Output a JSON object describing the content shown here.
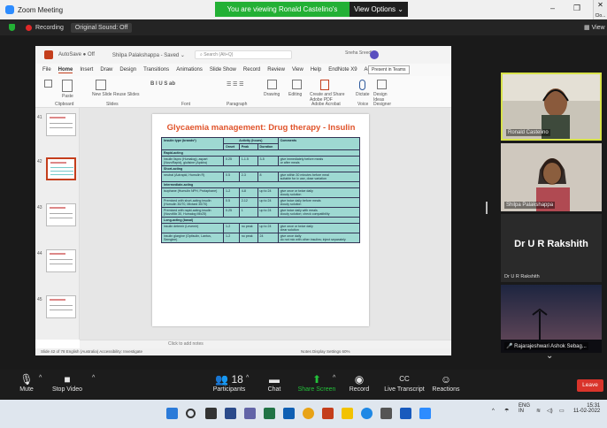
{
  "window": {
    "title": "Zoom Meeting"
  },
  "banner": {
    "viewing": "You are viewing Ronald Castelino's screen",
    "options": "View Options ⌄"
  },
  "window_controls": {
    "minimize": "–",
    "maximize": "❒",
    "close": "Clo..."
  },
  "recording": {
    "label": "Recording",
    "original_sound": "Original Sound: Off",
    "view": "View"
  },
  "ppt": {
    "app_title": "AutoSave ● Off",
    "doc_title": "Shilpa Palakshappa - Saved ⌄",
    "search_placeholder": "Search (Alt+Q)",
    "user": "Sneha Sreedhar",
    "menu": [
      "File",
      "Home",
      "Insert",
      "Draw",
      "Design",
      "Transitions",
      "Animations",
      "Slide Show",
      "Record",
      "Review",
      "View",
      "Help",
      "EndNote X9",
      "Acrobat"
    ],
    "present": "Present in Teams",
    "ribbon_labels": [
      "Paste",
      "Clipboard",
      "New Slide",
      "Reuse Slides",
      "Slides",
      "Font",
      "Paragraph",
      "Drawing",
      "Editing",
      "Create and Share Adobe PDF",
      "Adobe Acrobat",
      "Dictate",
      "Voice",
      "Design Ideas",
      "Designer"
    ],
    "notes": "Click to add notes",
    "status_left": "Slide 42 of 78    English (Australia)    Accessibility: Investigate",
    "status_right": "Notes    Display Settings                    60%"
  },
  "slide": {
    "title": "Glycaemia management: Drug therapy - Insulin",
    "headers": [
      "Insulin type (brands*)",
      "Activity (hours)",
      "Onset",
      "Peak",
      "Duration",
      "Comments"
    ],
    "rows": [
      {
        "section": "Rapid-acting"
      },
      {
        "cells": [
          "insulin lispro (Humalog), aspart (NovoRapid), glulisine (Apidra)",
          "0.25",
          "1-1.5",
          "3-5",
          "give immediately before meals",
          "or after meals"
        ]
      },
      {
        "section": "Short-acting"
      },
      {
        "cells": [
          "neutral (Actrapid, Humulin R)",
          "0.5",
          "2-3",
          "8",
          "give within 30 minutes before meal",
          "suitable for iv use, dose variation"
        ]
      },
      {
        "section": "Intermediate-acting"
      },
      {
        "cells": [
          "isophane (Humulin NPH, Protaphane)",
          "1-2",
          "4-8",
          "up to 24",
          "give once or twice daily",
          "cloudy solution"
        ]
      },
      {
        "cells": [
          "Premixed with short-acting insulin (Humulin 30/70, Mixtard 30/70)",
          "0.5",
          "2-12",
          "up to 24",
          "give twice daily before meals",
          "cloudy solution"
        ]
      },
      {
        "cells": [
          "Premixed with rapid-acting insulin (NovoMix 30, Humalog Mix25)",
          "0.25",
          "1",
          "up to 24",
          "give twice daily with meals",
          "cloudy solution; check compatibility"
        ]
      },
      {
        "section": "Long-acting (basal)"
      },
      {
        "cells": [
          "insulin detemir (Levemir)",
          "1-2",
          "no peak",
          "up to 24",
          "give once or twice daily",
          "clear solution"
        ]
      },
      {
        "cells": [
          "insulin glargine (Optisulin, Lantus, Semglee)",
          "1-2",
          "no peak",
          "24",
          "give once daily",
          "do not mix with other insulins; inject separately"
        ]
      }
    ]
  },
  "participants_gallery": [
    {
      "name": "Ronald Castelino",
      "kind": "video",
      "active": true
    },
    {
      "name": "Shilpa Palakshappa",
      "kind": "video",
      "active": false
    },
    {
      "bigname": "Dr U R Rakshith",
      "name": "Dr U R Rakshith",
      "kind": "name",
      "active": false
    },
    {
      "name": "Rajarajeshwari Ashok Sebag...",
      "kind": "sunset",
      "active": false
    }
  ],
  "controls": [
    {
      "key": "mute",
      "label": "Mute",
      "icon": "🎙"
    },
    {
      "key": "video",
      "label": "Stop Video",
      "icon": "■"
    },
    {
      "key": "participants",
      "label": "Participants",
      "icon": "👥 18"
    },
    {
      "key": "chat",
      "label": "Chat",
      "icon": "▬"
    },
    {
      "key": "share",
      "label": "Share Screen",
      "icon": "⬆"
    },
    {
      "key": "record",
      "label": "Record",
      "icon": "◉"
    },
    {
      "key": "transcript",
      "label": "Live Transcript",
      "icon": "CC"
    },
    {
      "key": "reactions",
      "label": "Reactions",
      "icon": "☺"
    }
  ],
  "leave": "Leave",
  "taskbar": {
    "lang": "ENG",
    "region": "IN",
    "time": "15:31",
    "date": "11-02-2022"
  },
  "colors": {
    "accent": "#23b035",
    "leave": "#d9342b",
    "ppt": "#c43e1c",
    "slide_title": "#e0532a",
    "table_bg": "#9ed9d2"
  }
}
